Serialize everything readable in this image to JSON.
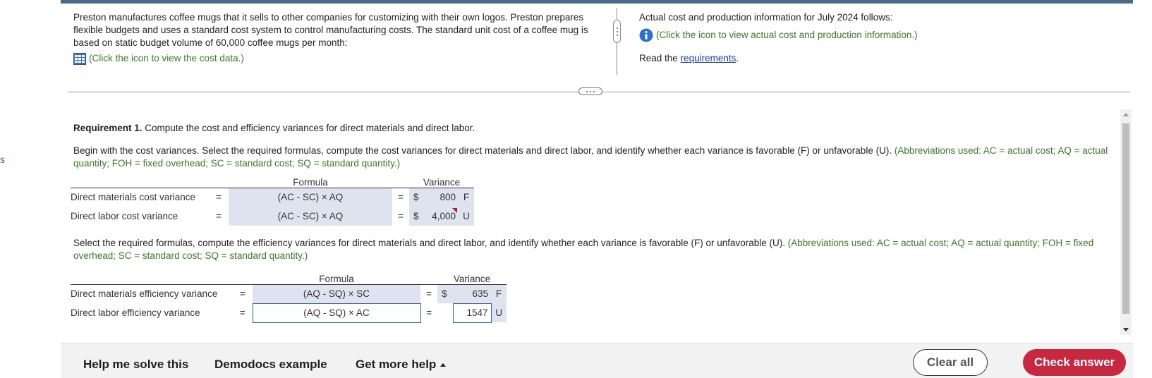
{
  "left_stub": "s",
  "intro": {
    "text": "Preston manufactures coffee mugs that it sells to other companies for customizing with their own logos. Preston prepares flexible budgets and uses a standard cost system to control manufacturing costs. The standard unit cost of a coffee mug is based on static budget volume of 60,000 coffee mugs per month:",
    "cost_data_link": "(Click the icon to view the cost data.)"
  },
  "right_info": {
    "text": "Actual cost and production information for July 2024 follows:",
    "actual_link": "(Click the icon to view actual cost and production information.)",
    "read_prefix": "Read the",
    "requirements_link": "requirements",
    "read_suffix": "."
  },
  "requirement": {
    "label": "Requirement 1.",
    "text": " Compute the cost and efficiency variances for direct materials and direct labor.",
    "cost_instr": "Begin with the cost variances. Select the required formulas, compute the cost variances for direct materials and direct labor, and identify whether each variance is favorable (F) or unfavorable (U). ",
    "cost_abbrev": "(Abbreviations used: AC = actual cost; AQ = actual quantity; FOH = fixed overhead; SC = standard cost; SQ = standard quantity.)",
    "eff_instr": "Select the required formulas, compute the efficiency variances for direct materials and direct labor, and identify whether each variance is favorable (F) or unfavorable (U). ",
    "eff_abbrev": "(Abbreviations used: AC = actual cost; AQ = actual quantity; FOH = fixed overhead; SC = standard cost; SQ = standard quantity.)"
  },
  "cost_table": {
    "header_formula": "Formula",
    "header_variance": "Variance",
    "rows": [
      {
        "label": "Direct materials cost variance",
        "eq": "=",
        "formula": "(AC - SC) × AQ",
        "eq2": "=",
        "currency": "$",
        "value": "800",
        "fu": "F"
      },
      {
        "label": "Direct labor cost variance",
        "eq": "=",
        "formula": "(AC - SC) × AQ",
        "eq2": "=",
        "currency": "$",
        "value": "4,000",
        "fu": "U"
      }
    ]
  },
  "eff_table": {
    "header_formula": "Formula",
    "header_variance": "Variance",
    "rows": [
      {
        "label": "Direct materials efficiency variance",
        "eq": "=",
        "formula": "(AQ - SQ) × SC",
        "eq2": "=",
        "currency": "$",
        "value": "635",
        "fu": "F"
      },
      {
        "label": "Direct labor efficiency variance",
        "eq": "=",
        "formula": "(AQ - SQ) × AC",
        "eq2": "=",
        "currency": "",
        "value": "1547",
        "fu": "U"
      }
    ]
  },
  "bottom": {
    "help": "Help me solve this",
    "demodocs": "Demodocs example",
    "more_help": "Get more help",
    "clear_all": "Clear all",
    "check_answer": "Check answer"
  },
  "colors": {
    "accent_green": "#3a7a2a",
    "check_red": "#c8283f",
    "link_blue": "#1a35c8",
    "cell_fill": "#dfe3f0"
  }
}
